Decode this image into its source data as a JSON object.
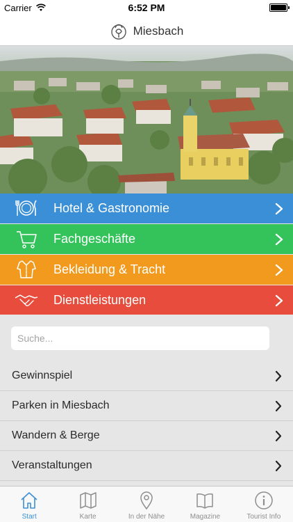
{
  "status_bar": {
    "carrier": "Carrier",
    "time": "6:52 PM"
  },
  "nav": {
    "title": "Miesbach",
    "logo_icon": "knot-emblem-icon"
  },
  "hero": {
    "image": "aerial-town-photo"
  },
  "categories": [
    {
      "label": "Hotel & Gastronomie",
      "icon": "plate-cutlery-icon",
      "color": "#3a8fd6"
    },
    {
      "label": "Fachgeschäfte",
      "icon": "shopping-cart-icon",
      "color": "#34c25a"
    },
    {
      "label": "Bekleidung & Tracht",
      "icon": "shirt-icon",
      "color": "#f19a1d"
    },
    {
      "label": "Dienstleistungen",
      "icon": "handshake-icon",
      "color": "#e74c3c"
    }
  ],
  "search": {
    "placeholder": "Suche..."
  },
  "list": [
    {
      "label": "Gewinnspiel"
    },
    {
      "label": "Parken in Miesbach"
    },
    {
      "label": "Wandern & Berge"
    },
    {
      "label": "Veranstaltungen"
    }
  ],
  "tabs": [
    {
      "label": "Start",
      "icon": "home-icon",
      "active": true
    },
    {
      "label": "Karte",
      "icon": "map-icon",
      "active": false
    },
    {
      "label": "In der Nähe",
      "icon": "location-pin-icon",
      "active": false
    },
    {
      "label": "Magazine",
      "icon": "book-icon",
      "active": false
    },
    {
      "label": "Tourist Info",
      "icon": "info-icon",
      "active": false
    }
  ],
  "colors": {
    "accent": "#3a8fd6",
    "list_background": "#e6e6e6",
    "tab_inactive": "#8e8e8e"
  }
}
